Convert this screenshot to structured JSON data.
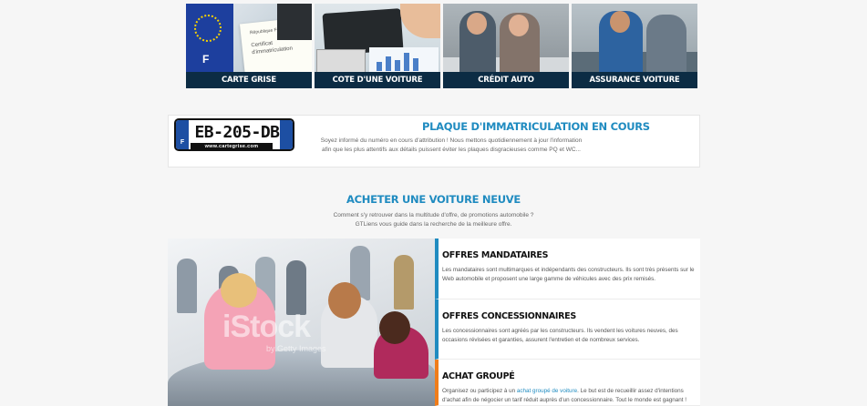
{
  "tiles": [
    {
      "label": "Carte grise"
    },
    {
      "label": "Cote d'une voiture"
    },
    {
      "label": "Crédit auto"
    },
    {
      "label": "Assurance voiture"
    }
  ],
  "plaque": {
    "plate_number": "EB-205-DB",
    "plate_country": "F",
    "plate_site": "www.cartegrise.com",
    "title": "Plaque d'immatriculation en cours",
    "text_line1": "Soyez informé du numéro en cours d'attribution ! Nous mettons quotidiennement à jour l'information",
    "text_line2": "afin que les plus attentifs aux détails puissent éviter les plaques disgracieuses comme PQ et WC..."
  },
  "acheter": {
    "title": "Acheter une voiture neuve",
    "subtitle_line1": "Comment s'y retrouver dans la multitude d'offre, de promotions automobile ?",
    "subtitle_line2": "GTLiens vous guide dans la recherche de la meilleure offre.",
    "photo_watermark": "iStock",
    "photo_watermark_sub": "by Getty Images"
  },
  "offers": [
    {
      "title": "Offres mandataires",
      "text": "Les mandataires sont multimarques et indépendants des constructeurs. Ils sont très présents sur le Web automobile et proposent une large gamme de véhicules avec des prix remisés."
    },
    {
      "title": "Offres concessionnaires",
      "text": "Les concessionnaires sont agréés par les constructeurs. Ils vendent les voitures neuves, des occasions révisées et garanties, assurent l'entretien et de nombreux services."
    },
    {
      "title": "Achat groupé",
      "text_before": "Organisez ou participez à un ",
      "link": "achat groupé de voiture",
      "text_after": ". Le but est de recueillir assez d'intentions d'achat afin de négocier un tarif réduit auprès d'un concessionnaire. Tout le monde est gagnant !"
    }
  ],
  "colors": {
    "accent_blue": "#1f8bc0",
    "accent_orange": "#f07d1a",
    "tile_caption_bg": "#0c2c44"
  }
}
